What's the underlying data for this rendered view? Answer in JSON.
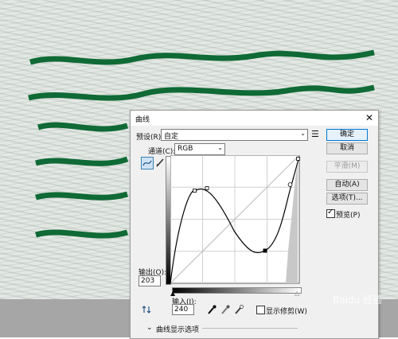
{
  "dialog": {
    "title": "曲线",
    "preset_label": "预设(R):",
    "preset_value": "自定",
    "channel_label": "通道(C):",
    "channel_value": "RGB",
    "output_label": "输出(O):",
    "output_value": "203",
    "input_label": "输入(I):",
    "input_value": "240",
    "show_clipping_label": "显示修剪(W)",
    "show_clipping_checked": false,
    "curve_options_label": "曲线显示选项",
    "buttons": {
      "ok": "确定",
      "cancel": "取消",
      "smooth": "平滑(M)",
      "auto": "自动(A)",
      "options": "选项(T)...",
      "preview": "预览(P)"
    },
    "preview_checked": true
  },
  "watermark": "Baidu 经验",
  "icons": {
    "close": "close-icon",
    "preset_menu": "menu-icon",
    "curve_tool": "curve-tool-icon",
    "pencil_tool": "pencil-icon",
    "target_adjust": "target-adjust-icon",
    "black_eyedropper": "eyedropper-black-icon",
    "gray_eyedropper": "eyedropper-gray-icon",
    "white_eyedropper": "eyedropper-white-icon",
    "expand": "chevron-down-icon"
  }
}
